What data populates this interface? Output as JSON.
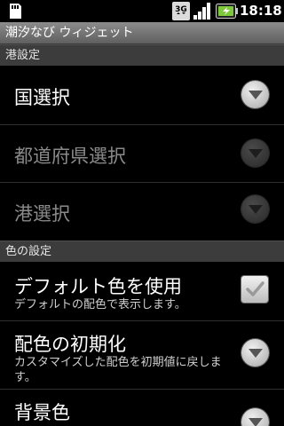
{
  "status_bar": {
    "network": "3G",
    "time": "18:18"
  },
  "app": {
    "title": "潮汐なび ウィジェット"
  },
  "sections": [
    {
      "header": "港設定",
      "items": [
        {
          "title": "国選択",
          "enabled": true,
          "widget": "dropdown"
        },
        {
          "title": "都道府県選択",
          "enabled": false,
          "widget": "dropdown"
        },
        {
          "title": "港選択",
          "enabled": false,
          "widget": "dropdown"
        }
      ]
    },
    {
      "header": "色の設定",
      "items": [
        {
          "title": "デフォルト色を使用",
          "summary": "デフォルトの配色で表示します。",
          "enabled": true,
          "widget": "checkbox",
          "checked": true
        },
        {
          "title": "配色の初期化",
          "summary": "カスタマイズした配色を初期値に戻します。",
          "enabled": true,
          "widget": "dropdown"
        },
        {
          "title": "背景色",
          "enabled": true,
          "widget": "dropdown"
        }
      ]
    }
  ],
  "colors": {
    "battery_accent": "#7ec93a",
    "category_bg": "#3c3c3c"
  }
}
